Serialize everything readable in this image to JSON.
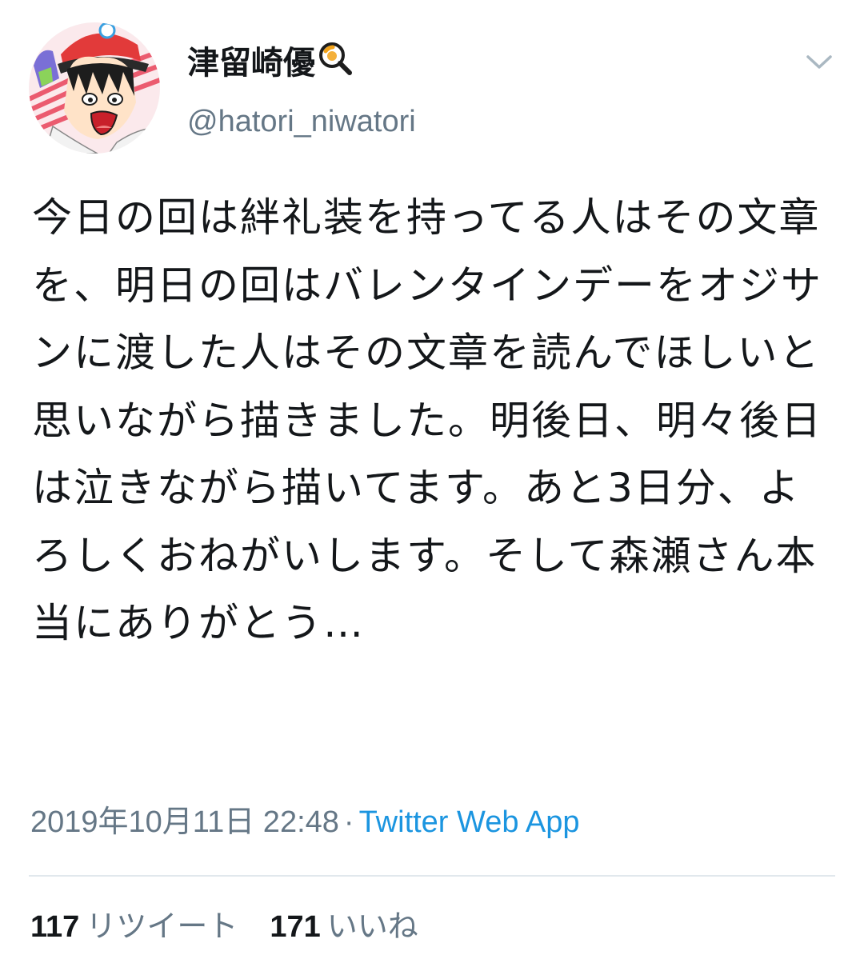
{
  "user": {
    "display_name": "津留崎優",
    "display_name_emoji_icon": "magnifying-glass-icon",
    "handle": "@hatori_niwatori",
    "avatar_icon": "avatar-manga-character"
  },
  "menu": {
    "icon": "chevron-down-icon"
  },
  "tweet": {
    "text": "今日の回は絆礼装を持ってる人はその文章を、明日の回はバレンタインデーをオジサンに渡した人はその文章を読んでほしいと思いながら描きました。明後日、明々後日は泣きながら描いてます。あと3日分、よろしくおねがいします。そして森瀬さん本当にありがとう…"
  },
  "meta": {
    "timestamp": "2019年10月11日 22:48",
    "separator": "·",
    "source": "Twitter Web App"
  },
  "stats": {
    "retweets_count": "117",
    "retweets_label": "リツイート",
    "likes_count": "171",
    "likes_label": "いいね"
  },
  "colors": {
    "text_primary": "#14171a",
    "text_secondary": "#657786",
    "link": "#1b95e0",
    "divider": "#e1e8ed"
  }
}
